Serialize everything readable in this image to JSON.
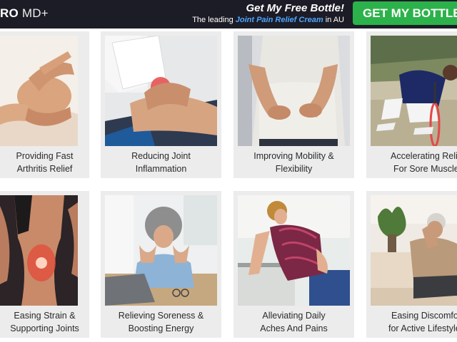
{
  "header": {
    "logo_bold": "RO",
    "logo_light": "MD+",
    "promo_headline": "Get My Free Bottle!",
    "promo_prefix": "The leading",
    "promo_highlight": "Joint Pain Relief Cream",
    "promo_suffix": "in AU",
    "cta_label": "GET MY BOTTLE"
  },
  "benefits": [
    {
      "line1": "Providing Fast",
      "line2": "Arthritis Relief",
      "icon": "hands-arthritis-photo"
    },
    {
      "line1": "Reducing Joint",
      "line2": "Inflammation",
      "icon": "knee-pain-photo"
    },
    {
      "line1": "Improving Mobility &",
      "line2": "Flexibility",
      "icon": "lower-back-pain-photo"
    },
    {
      "line1": "Accelerating Relief",
      "line2": "For Sore Muscles",
      "icon": "tennis-player-photo"
    },
    {
      "line1": "Easing Strain &",
      "line2": "Supporting Joints",
      "icon": "glowing-knee-photo"
    },
    {
      "line1": "Relieving Soreness &",
      "line2": "Boosting Energy",
      "icon": "tired-woman-laptop-photo"
    },
    {
      "line1": "Alleviating Daily",
      "line2": "Aches And Pains",
      "icon": "woman-back-ache-kitchen-photo"
    },
    {
      "line1": "Easing Discomfort",
      "line2": "for Active Lifestyle",
      "icon": "man-sofa-head-photo"
    }
  ]
}
